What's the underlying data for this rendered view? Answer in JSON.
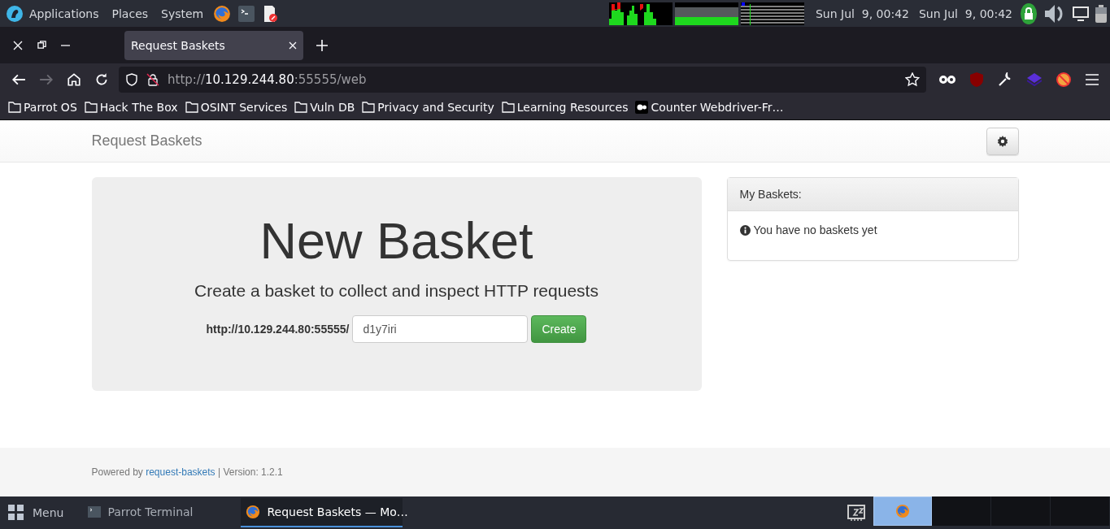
{
  "top_panel": {
    "menus": [
      "Applications",
      "Places",
      "System"
    ],
    "clocks": [
      "Sun Jul  9, 00:42",
      "Sun Jul  9, 00:42"
    ]
  },
  "browser": {
    "tabs": [
      {
        "label": "Request Baskets",
        "selected": true
      }
    ],
    "nav_buttons": [
      {
        "kind": "back",
        "disabled": false
      },
      {
        "kind": "forward",
        "disabled": true
      },
      {
        "kind": "home",
        "disabled": false
      },
      {
        "kind": "reload",
        "disabled": false
      }
    ],
    "url": {
      "scheme": "http://",
      "host": "10.129.244.80",
      "path": ":55555/web"
    },
    "bookmarks": [
      {
        "label": "Parrot OS",
        "kind": "folder"
      },
      {
        "label": "Hack The Box",
        "kind": "folder"
      },
      {
        "label": "OSINT Services",
        "kind": "folder"
      },
      {
        "label": "Vuln DB",
        "kind": "folder"
      },
      {
        "label": "Privacy and Security",
        "kind": "folder"
      },
      {
        "label": "Learning Resources",
        "kind": "folder"
      },
      {
        "label": "Counter Webdriver-Fr…",
        "kind": "site"
      }
    ]
  },
  "page": {
    "brand": "Request Baskets",
    "title": "New Basket",
    "subtitle": "Create a basket to collect and inspect HTTP requests",
    "url_prefix": "http://10.129.244.80:55555/",
    "basket_name": "d1y7iri",
    "create_button": "Create",
    "panel": {
      "heading": "My Baskets:",
      "message": "You have no baskets yet"
    },
    "footer": {
      "before": "Powered by",
      "link": "request-baskets",
      "after": "| Version: 1.2.1"
    }
  },
  "taskbar": {
    "menu": "Menu",
    "windows": [
      {
        "label": "Parrot Terminal",
        "kind": "terminal",
        "selected": false
      },
      {
        "label": "Request Baskets — Mo…",
        "kind": "browser",
        "selected": true
      }
    ],
    "workspaces": [
      {
        "selected": true
      },
      {
        "selected": false
      },
      {
        "selected": false
      },
      {
        "selected": false
      }
    ]
  }
}
